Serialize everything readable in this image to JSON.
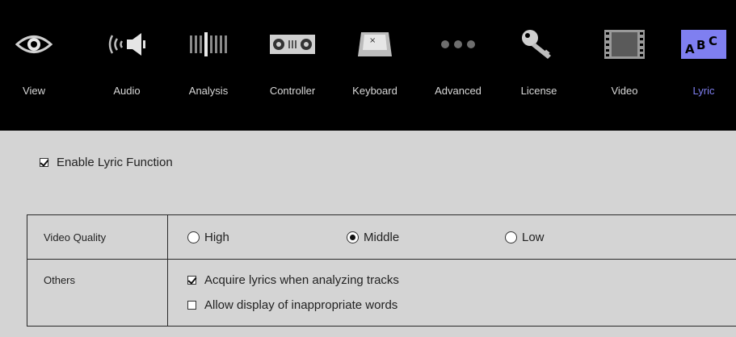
{
  "tabs": [
    {
      "label": "View",
      "icon": "eye-icon"
    },
    {
      "label": "Audio",
      "icon": "speaker-icon"
    },
    {
      "label": "Analysis",
      "icon": "waveform-icon"
    },
    {
      "label": "Controller",
      "icon": "controller-icon"
    },
    {
      "label": "Keyboard",
      "icon": "keyboard-key-icon"
    },
    {
      "label": "Advanced",
      "icon": "dots-icon"
    },
    {
      "label": "License",
      "icon": "key-icon"
    },
    {
      "label": "Video",
      "icon": "film-icon"
    },
    {
      "label": "Lyric",
      "icon": "abc-icon",
      "active": true
    }
  ],
  "enable": {
    "label": "Enable Lyric Function",
    "checked": true
  },
  "video_quality": {
    "label": "Video Quality",
    "options": [
      {
        "label": "High",
        "selected": false
      },
      {
        "label": "Middle",
        "selected": true
      },
      {
        "label": "Low",
        "selected": false
      }
    ]
  },
  "others": {
    "label": "Others",
    "options": [
      {
        "label": "Acquire lyrics when analyzing tracks",
        "checked": true
      },
      {
        "label": "Allow display of inappropriate words",
        "checked": false
      }
    ]
  },
  "colors": {
    "active_tab": "#7f7ff0",
    "topbar": "#000000",
    "panel": "#d4d4d4"
  }
}
